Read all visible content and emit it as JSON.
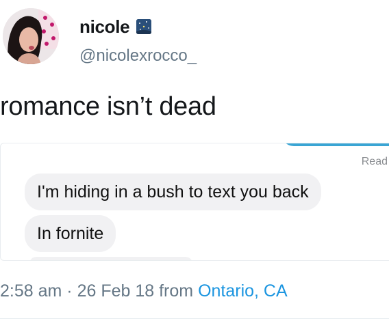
{
  "user": {
    "display_name": "nicole",
    "handle": "@nicolexrocco_",
    "name_emoji": "night-sky-emoji-icon"
  },
  "tweet": {
    "text": "romance isn’t dead"
  },
  "embedded_screenshot": {
    "read_receipt": "Read",
    "messages": [
      {
        "text": "I'm hiding in a bush to text you back"
      },
      {
        "text": "In fornite"
      }
    ]
  },
  "meta": {
    "time": "2:58 am",
    "separator": " · ",
    "date": "26 Feb 18",
    "from_label": " from ",
    "location": "Ontario, CA"
  },
  "colors": {
    "text": "#14171a",
    "secondary": "#657786",
    "link": "#1b95e0",
    "imessage_blue": "#3aa5d4",
    "bubble_gray": "#f1f1f3"
  }
}
